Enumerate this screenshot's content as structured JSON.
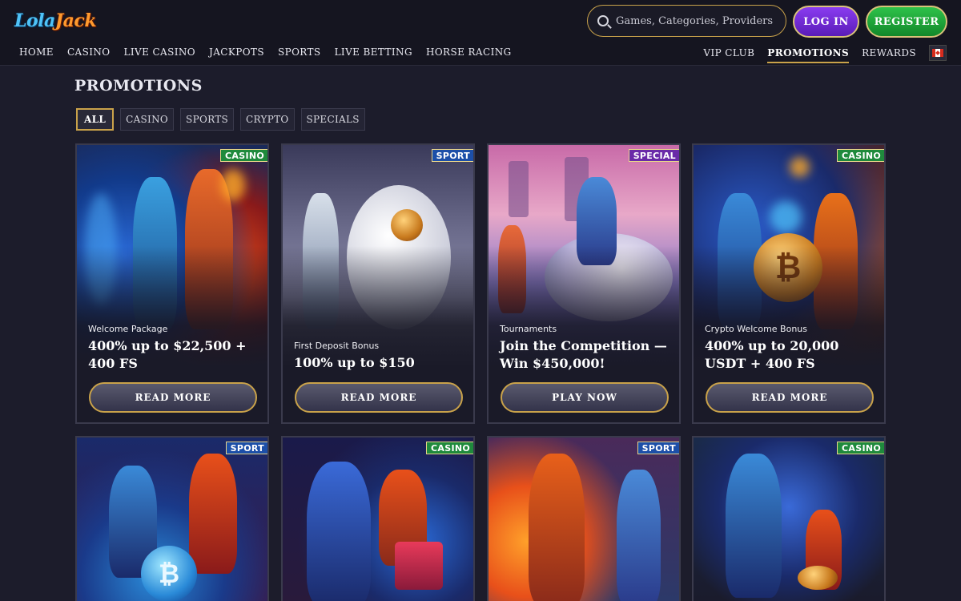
{
  "brand": {
    "logo_part1": "Lola",
    "logo_part2": "Jack"
  },
  "nav_left": [
    {
      "label": "HOME"
    },
    {
      "label": "CASINO"
    },
    {
      "label": "LIVE CASINO"
    },
    {
      "label": "JACKPOTS"
    },
    {
      "label": "SPORTS"
    },
    {
      "label": "LIVE BETTING"
    },
    {
      "label": "HORSE RACING"
    }
  ],
  "nav_right": [
    {
      "label": "VIP CLUB"
    },
    {
      "label": "PROMOTIONS"
    },
    {
      "label": "REWARDS"
    }
  ],
  "search": {
    "placeholder": "Games, Categories, Providers"
  },
  "auth": {
    "login": "LOG IN",
    "register": "REGISTER"
  },
  "page": {
    "title": "PROMOTIONS"
  },
  "filters": [
    "ALL",
    "CASINO",
    "SPORTS",
    "CRYPTO",
    "SPECIALS"
  ],
  "cards": [
    {
      "tag": "CASINO",
      "subtitle": "Welcome Package",
      "title": "400% up to $22,500 + 400 FS",
      "button": "READ MORE"
    },
    {
      "tag": "SPORT",
      "subtitle": "First Deposit Bonus",
      "title": "100% up to $150",
      "button": "READ MORE"
    },
    {
      "tag": "SPECIAL",
      "subtitle": "Tournaments",
      "title": "Join the Competition — Win $450,000!",
      "button": "PLAY NOW"
    },
    {
      "tag": "CASINO",
      "subtitle": "Crypto Welcome Bonus",
      "title": "400% up to 20,000 USDT + 400 FS",
      "button": "READ MORE"
    },
    {
      "tag": "SPORT"
    },
    {
      "tag": "CASINO"
    },
    {
      "tag": "SPORT"
    },
    {
      "tag": "CASINO"
    }
  ],
  "colors": {
    "accent_gold": "#c9a24a",
    "login_purple": "#8a3cf0",
    "register_green": "#2ec24a",
    "casino_tag": "#1f8a3c",
    "sport_tag": "#1c4fa8",
    "special_tag": "#6a2aa8"
  }
}
